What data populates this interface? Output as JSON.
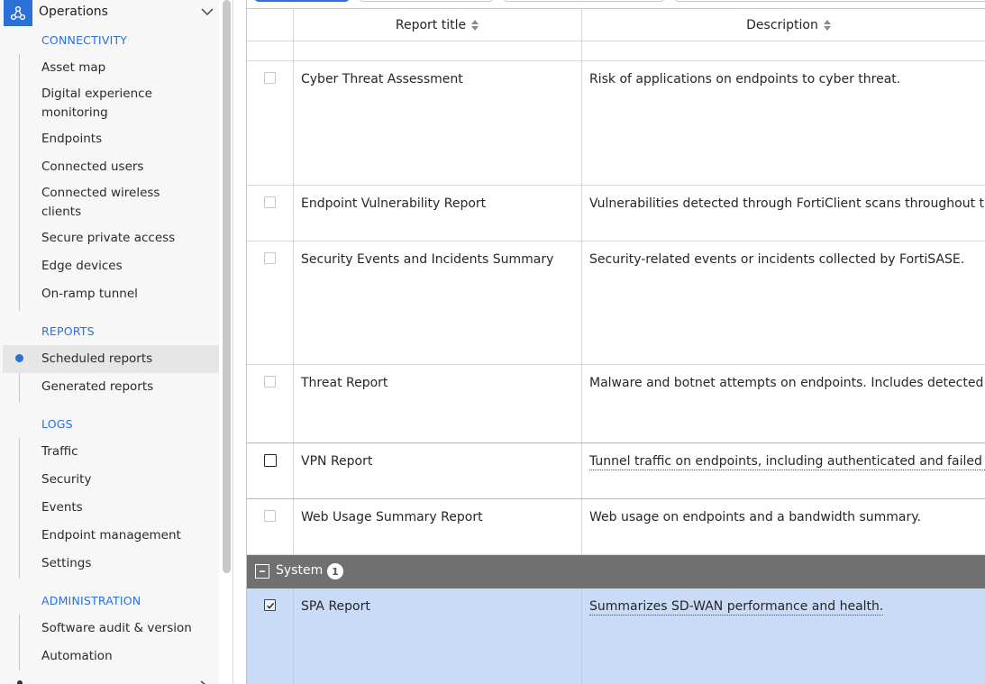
{
  "sidebar": {
    "section_header": "Operations",
    "groups": {
      "connectivity": "CONNECTIVITY",
      "reports": "REPORTS",
      "logs": "LOGS",
      "administration": "ADMINISTRATION"
    },
    "items": {
      "asset_map": "Asset map",
      "dem_line1": "Digital experience",
      "dem_line2": "monitoring",
      "endpoints": "Endpoints",
      "connected_users": "Connected users",
      "wireless_line1": "Connected wireless",
      "wireless_line2": "clients",
      "secure_private_access": "Secure private access",
      "edge_devices": "Edge devices",
      "onramp_tunnel": "On-ramp tunnel",
      "scheduled_reports": "Scheduled reports",
      "generated_reports": "Generated reports",
      "traffic": "Traffic",
      "security": "Security",
      "events": "Events",
      "endpoint_management": "Endpoint management",
      "settings": "Settings",
      "software_audit": "Software audit & version",
      "automation": "Automation"
    }
  },
  "table": {
    "columns": {
      "title": "Report title",
      "description": "Description"
    },
    "rows": [
      {
        "title": "Cyber Threat Assessment",
        "description": "Risk of applications on endpoints to cyber threat."
      },
      {
        "title": "Endpoint Vulnerability Report",
        "description": "Vulnerabilities detected through FortiClient scans throughout the ne"
      },
      {
        "title": "Security Events and Incidents Summary",
        "description": "Security-related events or incidents collected by FortiSASE."
      },
      {
        "title": "Threat Report",
        "description": "Malware and botnet attempts on endpoints. Includes detected malv"
      },
      {
        "title": "VPN Report",
        "description": "Tunnel traffic on endpoints, including authenticated and failed user"
      },
      {
        "title": "Web Usage Summary Report",
        "description": "Web usage on endpoints and a bandwidth summary."
      }
    ],
    "group": {
      "label": "System",
      "count": "1"
    },
    "system_rows": [
      {
        "title": "SPA Report",
        "description": "Summarizes SD-WAN performance and health."
      }
    ]
  },
  "colors": {
    "accent": "#2c6fd6",
    "selected_row": "#c9dbf7",
    "group_bar": "#707070"
  }
}
